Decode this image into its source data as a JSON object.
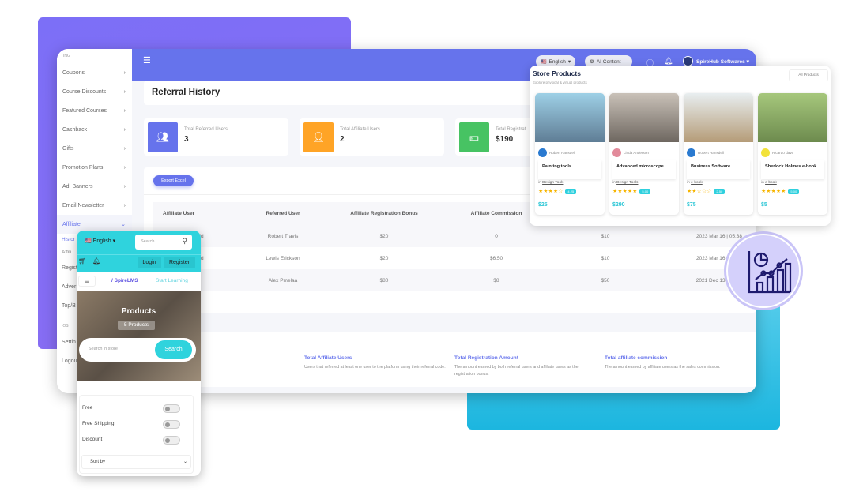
{
  "sidebar": {
    "caption": "ING",
    "items": [
      "Coupons",
      "Course Discounts",
      "Featured Courses",
      "Cashback",
      "Gifts",
      "Promotion Plans",
      "Ad. Banners",
      "Email Newsletter"
    ],
    "active": "Affiliate",
    "sub": [
      "Histor",
      "Affili"
    ],
    "more": [
      "Regist",
      "Adver",
      "Top/B"
    ],
    "caption2": "IOS",
    "bottom": [
      "Settin",
      "Logou"
    ]
  },
  "header": {
    "language": "English",
    "ai_content": "AI Content",
    "user": "SpireHub Softwares"
  },
  "page": {
    "title": "Referral History"
  },
  "stats": [
    {
      "label": "Total Referred Users",
      "value": "3",
      "color": "#6673ec"
    },
    {
      "label": "Total Affiliate Users",
      "value": "2",
      "color": "#ffa426"
    },
    {
      "label": "Total Registrat",
      "value": "$190",
      "color": "#47c363"
    }
  ],
  "table": {
    "export": "Export Excel",
    "headers": [
      "Affiliate User",
      "Referred User",
      "Affiliate Registration Bonus",
      "Affiliate Commission",
      "",
      ""
    ],
    "rows": [
      [
        "eld",
        "Robert Travis",
        "$20",
        "0",
        "$10",
        "2023 Mar 16 | 05:38"
      ],
      [
        "eld",
        "Lewis Erickson",
        "$20",
        "$6.50",
        "$10",
        "2023 Mar 16 | 05:26"
      ],
      [
        "",
        "Alex Pmelaa",
        "$80",
        "$8",
        "$50",
        "2021 Dec 13 | 02:00"
      ]
    ]
  },
  "info": [
    {
      "title": "rs",
      "text": "n the platform using the referral code."
    },
    {
      "title": "Total Affiliate Users",
      "text": "Users that referred at least one user to the platform using their referral code."
    },
    {
      "title": "Total Registration Amount",
      "text": "The amount earned by both referral users and affiliate users as the registration bonus."
    },
    {
      "title": "Total affiliate commission",
      "text": "The amount earned by affiliate users as the sales commission."
    }
  ],
  "store": {
    "title": "Store Products",
    "subtitle": "Explore physical & virtual products",
    "all": "All Products",
    "products": [
      {
        "author": "Robert Ransdell",
        "name": "Painting tools",
        "category": "Design Tools",
        "stars": 4,
        "rating": "4.25",
        "price": "$25"
      },
      {
        "author": "Linda Anderson",
        "name": "Advanced microscope",
        "category": "Design Tools",
        "stars": 5,
        "rating": "5.00",
        "price": "$290"
      },
      {
        "author": "Robert Ransdell",
        "name": "Business Software",
        "category": "e-book",
        "stars": 2,
        "rating": "2.50",
        "price": "$75"
      },
      {
        "author": "Ricardo dave",
        "name": "Sherlock Holmes e-book",
        "category": "e-book",
        "stars": 5,
        "rating": "5.00",
        "price": "$5"
      }
    ]
  },
  "phone": {
    "language": "English",
    "search_placeholder": "Search...",
    "login": "Login",
    "register": "Register",
    "logo": "SpireLMS",
    "start": "Start Learning",
    "hero_title": "Products",
    "hero_count": "5 Products",
    "store_search_placeholder": "Search in store",
    "search_btn": "Search",
    "filters": [
      "Free",
      "Free Shipping",
      "Discount"
    ],
    "sort": "Sort by"
  },
  "colors": {
    "primary": "#6673ec",
    "accent": "#2fd3dd"
  }
}
